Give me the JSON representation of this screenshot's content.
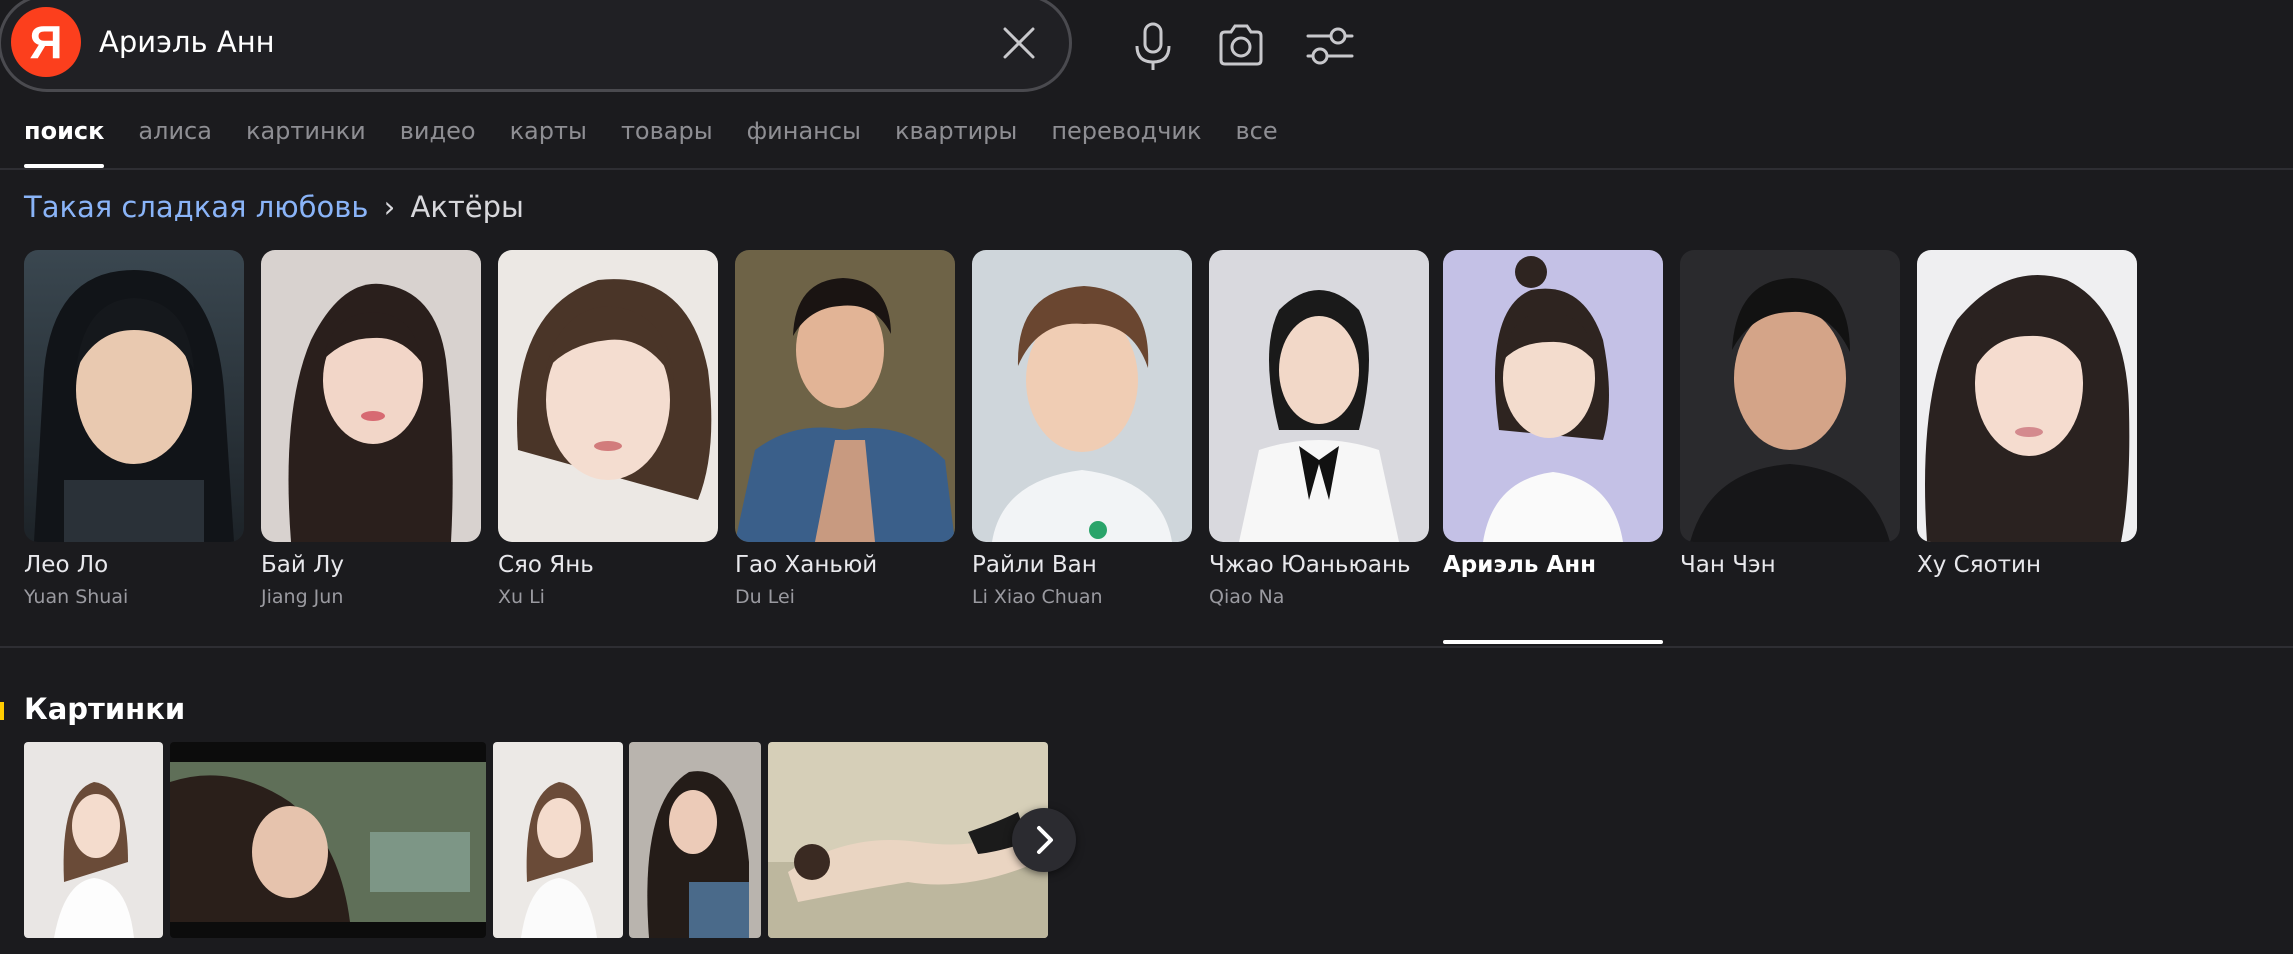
{
  "search": {
    "logo_letter": "Я",
    "query": "Ариэль Анн",
    "brand_color": "#fc3f1d"
  },
  "toolbar": {
    "icons": [
      "close-icon",
      "microphone-icon",
      "camera-icon",
      "filter-settings-icon"
    ]
  },
  "tabs": [
    {
      "label": "поиск",
      "active": true
    },
    {
      "label": "алиса"
    },
    {
      "label": "картинки"
    },
    {
      "label": "видео"
    },
    {
      "label": "карты"
    },
    {
      "label": "товары"
    },
    {
      "label": "финансы"
    },
    {
      "label": "квартиры"
    },
    {
      "label": "переводчик"
    },
    {
      "label": "все"
    }
  ],
  "breadcrumb": {
    "link": "Такая сладкая любовь",
    "separator": "›",
    "current": "Актёры",
    "link_color": "#8ab4f8"
  },
  "actors": [
    {
      "name": "Лео Ло",
      "role": "Yuan Shuai"
    },
    {
      "name": "Бай Лу",
      "role": "Jiang Jun"
    },
    {
      "name": "Сяо Янь",
      "role": "Xu Li"
    },
    {
      "name": "Гао Ханьюй",
      "role": "Du Lei"
    },
    {
      "name": "Райли Ван",
      "role": "Li Xiao Chuan"
    },
    {
      "name": "Чжао Юаньюань",
      "role": "Qiao Na"
    },
    {
      "name": "Ариэль Анн",
      "role": "",
      "active": true
    },
    {
      "name": "Чан Чэн",
      "role": ""
    },
    {
      "name": "Ху Сяотин",
      "role": ""
    }
  ],
  "images_section": {
    "title": "Картинки",
    "accent_color": "#ffcc00",
    "thumb_count": 5,
    "next_icon": "chevron-right-icon"
  }
}
